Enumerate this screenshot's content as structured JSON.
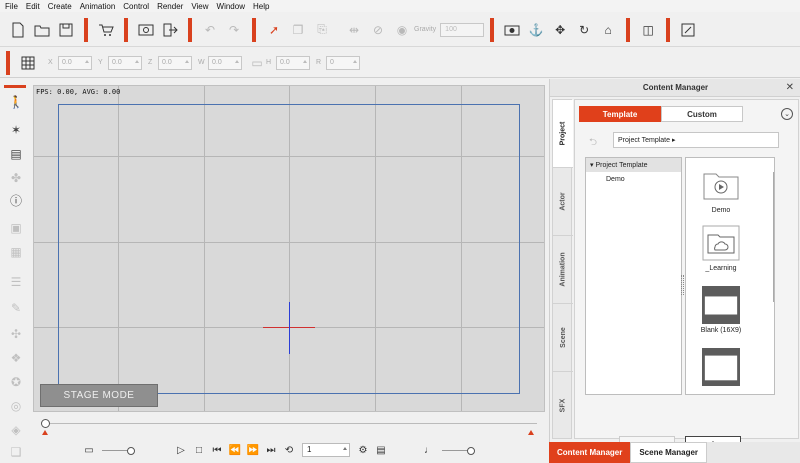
{
  "menu": [
    "File",
    "Edit",
    "Create",
    "Animation",
    "Control",
    "Render",
    "View",
    "Window",
    "Help"
  ],
  "toolbar": {
    "speed_label": "Gravity",
    "speed_value": "100",
    "icons": [
      "new-file-icon",
      "open-folder-icon",
      "save-icon",
      "cart-icon",
      "preview-icon",
      "export-icon",
      "undo-icon",
      "redo-icon",
      "select-arrow-icon",
      "copy-icon",
      "paste-icon",
      "flip-icon",
      "align-icon",
      "eye-icon",
      "camera-icon",
      "anchor-icon",
      "move-icon",
      "rotate-icon",
      "home-icon",
      "split-icon",
      "script-icon"
    ]
  },
  "transform_bar": {
    "fields": [
      {
        "label": "X",
        "value": "0.0"
      },
      {
        "label": "Y",
        "value": "0.0"
      },
      {
        "label": "Z",
        "value": "0.0"
      },
      {
        "label": "W",
        "value": "0.0"
      },
      {
        "label": "H",
        "value": "0.0"
      },
      {
        "label": "R",
        "value": "0"
      }
    ]
  },
  "viewport": {
    "fps_text": "FPS: 0.00, AVG: 0.00",
    "stage_mode_label": "STAGE MODE"
  },
  "playback": {
    "frame_value": "1",
    "controls": [
      "play",
      "stop",
      "first-frame",
      "prev-key",
      "next-key",
      "last-frame",
      "loop"
    ]
  },
  "content_manager": {
    "title": "Content Manager",
    "side_tabs": [
      "Project",
      "Actor",
      "Animation",
      "Scene",
      "SFX"
    ],
    "active_side_tab": "Project",
    "tabs": [
      "Template",
      "Custom"
    ],
    "active_tab": "Template",
    "breadcrumb": "Project Template ▸",
    "tree_root": "Project Template",
    "tree_children": [
      "Demo"
    ],
    "thumbnails": [
      {
        "label": "Demo",
        "icon": "play-folder-icon"
      },
      {
        "label": "_Learning",
        "icon": "cloud-folder-icon"
      },
      {
        "label": "Blank (16X9)",
        "icon": "blank-16x9-icon"
      },
      {
        "label": "",
        "icon": "blank-4x3-icon"
      }
    ],
    "add_button": "+",
    "down_button": "↓"
  },
  "bottom_tabs": [
    "Content Manager",
    "Scene Manager"
  ],
  "colors": {
    "accent": "#e0401b",
    "stage_border": "#4b72b0",
    "axis_x": "#d03030",
    "axis_y": "#2b3ed6"
  }
}
